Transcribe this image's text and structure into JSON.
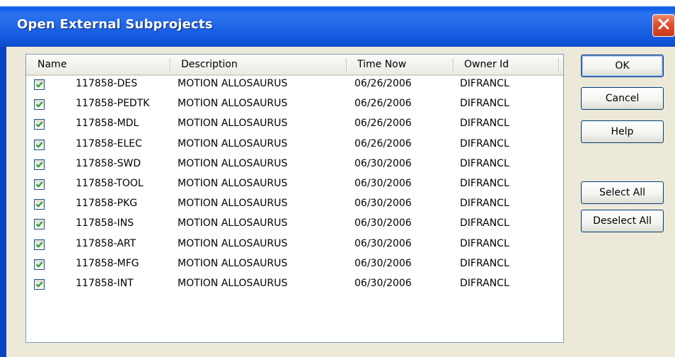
{
  "window": {
    "title": "Open External Subprojects"
  },
  "list": {
    "columns": [
      "Name",
      "Description",
      "Time Now",
      "Owner Id"
    ],
    "rows": [
      {
        "checked": true,
        "name": "117858-DES",
        "description": "MOTION ALLOSAURUS",
        "time": "06/26/2006",
        "owner": "DIFRANCL"
      },
      {
        "checked": true,
        "name": "117858-PEDTK",
        "description": "MOTION ALLOSAURUS",
        "time": "06/26/2006",
        "owner": "DIFRANCL"
      },
      {
        "checked": true,
        "name": "117858-MDL",
        "description": "MOTION ALLOSAURUS",
        "time": "06/26/2006",
        "owner": "DIFRANCL"
      },
      {
        "checked": true,
        "name": "117858-ELEC",
        "description": "MOTION ALLOSAURUS",
        "time": "06/26/2006",
        "owner": "DIFRANCL"
      },
      {
        "checked": true,
        "name": "117858-SWD",
        "description": "MOTION ALLOSAURUS",
        "time": "06/30/2006",
        "owner": "DIFRANCL"
      },
      {
        "checked": true,
        "name": "117858-TOOL",
        "description": "MOTION ALLOSAURUS",
        "time": "06/30/2006",
        "owner": "DIFRANCL"
      },
      {
        "checked": true,
        "name": "117858-PKG",
        "description": "MOTION ALLOSAURUS",
        "time": "06/30/2006",
        "owner": "DIFRANCL"
      },
      {
        "checked": true,
        "name": "117858-INS",
        "description": "MOTION ALLOSAURUS",
        "time": "06/30/2006",
        "owner": "DIFRANCL"
      },
      {
        "checked": true,
        "name": "117858-ART",
        "description": "MOTION ALLOSAURUS",
        "time": "06/30/2006",
        "owner": "DIFRANCL"
      },
      {
        "checked": true,
        "name": "117858-MFG",
        "description": "MOTION ALLOSAURUS",
        "time": "06/30/2006",
        "owner": "DIFRANCL"
      },
      {
        "checked": true,
        "name": "117858-INT",
        "description": "MOTION ALLOSAURUS",
        "time": "06/30/2006",
        "owner": "DIFRANCL"
      }
    ]
  },
  "buttons": {
    "ok": "OK",
    "cancel": "Cancel",
    "help": "Help",
    "select_all": "Select All",
    "deselect_all": "Deselect All"
  },
  "icons": {
    "close": "close-icon",
    "checkbox": "checkmark-icon"
  },
  "colors": {
    "titlebar": "#0a58e8",
    "client_bg": "#ece9d8",
    "close": "#e0512e",
    "check": "#21a121"
  }
}
